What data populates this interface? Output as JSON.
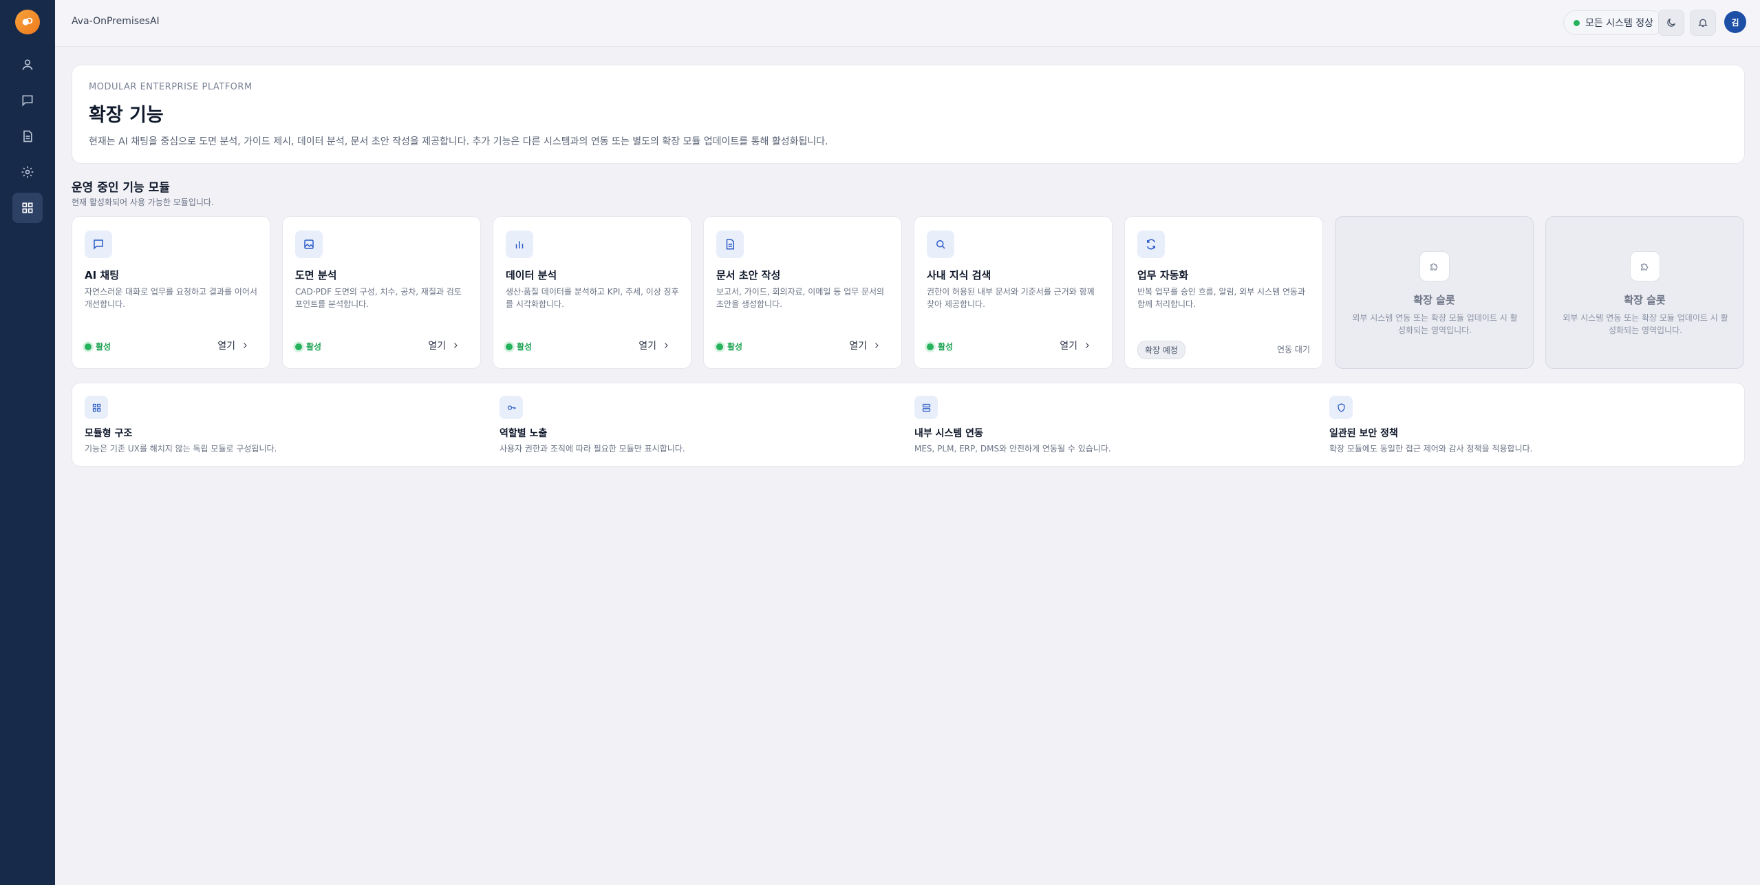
{
  "app": {
    "title": "Ava-OnPremisesAI"
  },
  "sidebar": {
    "items": [
      {
        "icon": "user-icon"
      },
      {
        "icon": "chat-icon"
      },
      {
        "icon": "document-icon"
      },
      {
        "icon": "gear-icon"
      },
      {
        "icon": "grid-icon",
        "active": true
      }
    ]
  },
  "topbar": {
    "status": "모든 시스템 정상",
    "avatar": "김"
  },
  "hero": {
    "eyebrow": "MODULAR ENTERPRISE PLATFORM",
    "title": "확장 기능",
    "description": "현재는 AI 채팅을 중심으로 도면 분석, 가이드 제시, 데이터 분석, 문서 초안 작성을 제공합니다. 추가 기능은 다른 시스템과의 연동 또는 별도의 확장 모듈 업데이트를 통해 활성화됩니다."
  },
  "section": {
    "title": "운영 중인 기능 모듈",
    "subtitle": "현재 활성화되어 사용 가능한 모듈입니다."
  },
  "modules": [
    {
      "title": "AI 채팅",
      "desc": "자연스러운 대화로 업무를 요청하고 결과를 이어서 개선합니다.",
      "status": "활성",
      "action": "열기",
      "icon": "chat-icon"
    },
    {
      "title": "도면 분석",
      "desc": "CAD·PDF 도면의 구성, 치수, 공차, 재질과 검토 포인트를 분석합니다.",
      "status": "활성",
      "action": "열기",
      "icon": "image-icon"
    },
    {
      "title": "데이터 분석",
      "desc": "생산·품질 데이터를 분석하고 KPI, 추세, 이상 징후를 시각화합니다.",
      "status": "활성",
      "action": "열기",
      "icon": "bar-chart-icon"
    },
    {
      "title": "문서 초안 작성",
      "desc": "보고서, 가이드, 회의자료, 이메일 등 업무 문서의 초안을 생성합니다.",
      "status": "활성",
      "action": "열기",
      "icon": "document-icon"
    },
    {
      "title": "사내 지식 검색",
      "desc": "권한이 허용된 내부 문서와 기준서를 근거와 함께 찾아 제공합니다.",
      "status": "활성",
      "action": "열기",
      "icon": "search-icon"
    },
    {
      "title": "업무 자동화",
      "desc": "반복 업무를 승인 흐름, 알림, 외부 시스템 연동과 함께 처리합니다.",
      "badge": "확장 예정",
      "wait": "연동 대기",
      "icon": "refresh-icon"
    }
  ],
  "slots": [
    {
      "title": "확장 슬롯",
      "desc": "외부 시스템 연동 또는 확장 모듈 업데이트 시 활성화되는 영역입니다."
    },
    {
      "title": "확장 슬롯",
      "desc": "외부 시스템 연동 또는 확장 모듈 업데이트 시 활성화되는 영역입니다."
    }
  ],
  "features": [
    {
      "title": "모듈형 구조",
      "desc": "기능은 기존 UX를 해치지 않는 독립 모듈로 구성됩니다.",
      "icon": "grid-icon"
    },
    {
      "title": "역할별 노출",
      "desc": "사용자 권한과 조직에 따라 필요한 모듈만 표시합니다.",
      "icon": "key-icon"
    },
    {
      "title": "내부 시스템 연동",
      "desc": "MES, PLM, ERP, DMS와 안전하게 연동될 수 있습니다.",
      "icon": "server-icon"
    },
    {
      "title": "일관된 보안 정책",
      "desc": "확장 모듈에도 동일한 접근 제어와 감사 정책을 적용합니다.",
      "icon": "shield-icon"
    }
  ]
}
